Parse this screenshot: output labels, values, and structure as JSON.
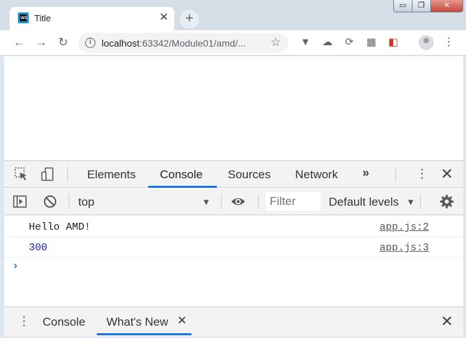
{
  "browser": {
    "tab_title": "Title",
    "tab_close": "✕",
    "new_tab": "+",
    "url_host": "localhost",
    "url_rest": ":63342/Module01/amd/...",
    "win_minimize": "▭",
    "win_maximize": "❐",
    "win_close": "✕"
  },
  "devtools": {
    "tabs": [
      "Elements",
      "Console",
      "Sources",
      "Network"
    ],
    "active_tab": "Console",
    "more_tabs": "»",
    "console_toolbar": {
      "context": "top",
      "filter_placeholder": "Filter",
      "levels": "Default levels"
    },
    "messages": [
      {
        "text": "Hello AMD!",
        "source": "app.js:2"
      },
      {
        "text": "300",
        "source": "app.js:3"
      }
    ],
    "prompt": "›",
    "drawer": {
      "tabs": [
        "Console",
        "What's New"
      ],
      "active_tab": "What's New",
      "tab_close": "✕"
    }
  },
  "colors": {
    "accent": "#1a73e8",
    "number_text": "#1a1aa6"
  }
}
